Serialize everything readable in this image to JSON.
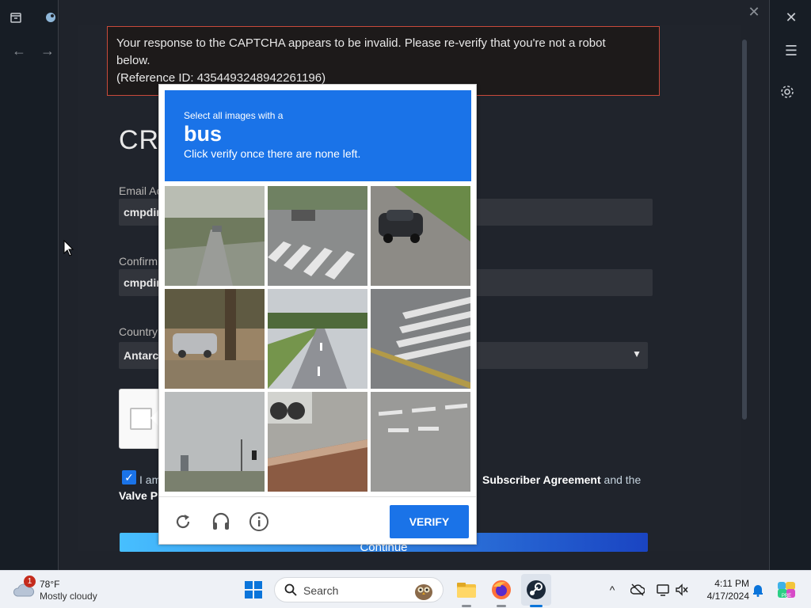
{
  "steam": {
    "modal_close": "✕",
    "window_close": "✕",
    "menu": "☰"
  },
  "error": {
    "line1": "Your response to the CAPTCHA appears to be invalid. Please re-verify that you're not a robot",
    "line2": "below.",
    "line3": "(Reference ID: 4354493248942261196)"
  },
  "form": {
    "heading": "CRI",
    "email_label": "Email Ac",
    "email_value": "cmpdir",
    "confirm_label": "Confirm",
    "confirm_value": "cmpdir",
    "country_label": "Country",
    "country_value": "Antarc",
    "agree_prefix": "I am",
    "agree_suffix_pre": "",
    "subscriber_agreement": "Subscriber Agreement",
    "agree_and": " and the",
    "valve_privacy": "Valve Pr",
    "continue_label": "Continue"
  },
  "captcha": {
    "instruction": "Select all images with a",
    "target": "bus",
    "subtext": "Click verify once there are none left.",
    "verify_label": "VERIFY"
  },
  "taskbar": {
    "weather_badge": "1",
    "temperature": "78°F",
    "condition": "Mostly cloudy",
    "search_label": "Search",
    "time": "4:11 PM",
    "date": "4/17/2024"
  },
  "colors": {
    "captcha_blue": "#1a73e8",
    "error_border": "#c94a3b",
    "steam_bg": "#1f232b"
  }
}
